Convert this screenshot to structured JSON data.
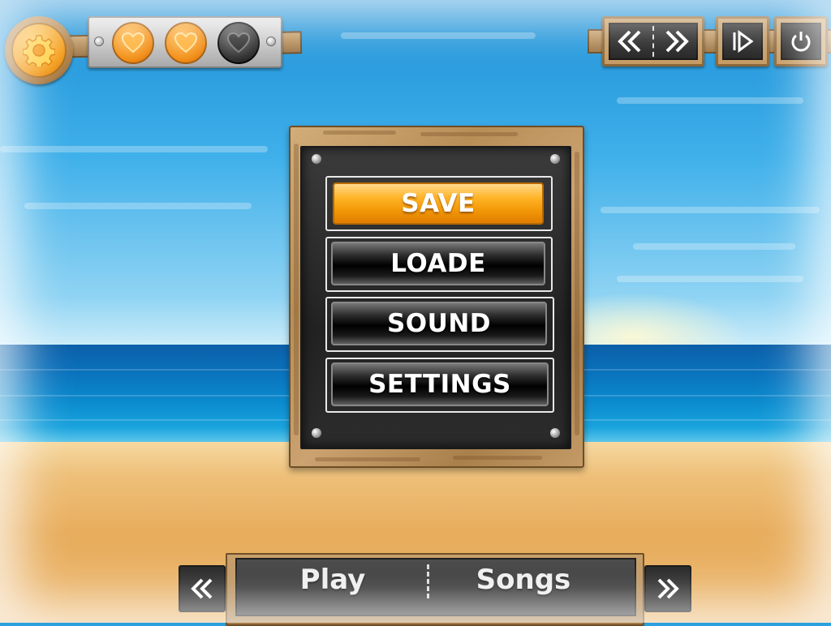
{
  "menu": {
    "items": [
      {
        "label": "SAVE",
        "state": "active"
      },
      {
        "label": "LOADE",
        "state": "normal"
      },
      {
        "label": "SOUND",
        "state": "normal"
      },
      {
        "label": "SETTINGS",
        "state": "normal"
      }
    ]
  },
  "hud": {
    "settings_icon": "gear-icon",
    "lives": [
      {
        "icon": "heart-icon",
        "state": "full"
      },
      {
        "icon": "heart-icon",
        "state": "full"
      },
      {
        "icon": "heart-icon",
        "state": "empty"
      }
    ],
    "controls": [
      {
        "icon": "rewind-icon"
      },
      {
        "icon": "fast-forward-icon"
      },
      {
        "icon": "play-icon"
      },
      {
        "icon": "power-icon"
      }
    ]
  },
  "bottom_bar": {
    "left_label": "Play",
    "right_label": "Songs",
    "prev_icon": "double-chevron-left-icon",
    "next_icon": "double-chevron-right-icon"
  },
  "colors": {
    "accent": "#f7a11a",
    "button_dark": "#1a1a1a",
    "sky": "#3fb0ea",
    "sand": "#e8ad5d",
    "wood": "#b88e57"
  }
}
